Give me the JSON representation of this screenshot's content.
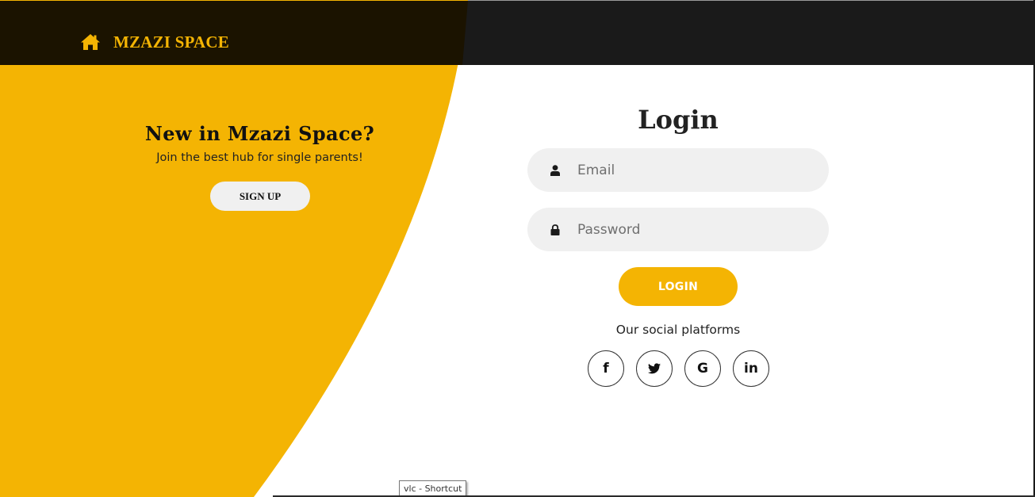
{
  "brand": {
    "name": "MZAZI SPACE",
    "icon": "home-icon"
  },
  "promo": {
    "title": "New in Mzazi Space?",
    "subtitle": "Join the best hub for single parents!",
    "signup_label": "SIGN UP"
  },
  "login": {
    "title": "Login",
    "email": {
      "placeholder": "Email",
      "value": "",
      "icon": "user-icon"
    },
    "password": {
      "placeholder": "Password",
      "value": "",
      "icon": "lock-icon"
    },
    "button_label": "LOGIN"
  },
  "social": {
    "heading": "Our social platforms",
    "platforms": [
      {
        "name": "facebook",
        "glyph": "f"
      },
      {
        "name": "twitter",
        "glyph": ""
      },
      {
        "name": "google",
        "glyph": "G"
      },
      {
        "name": "linkedin",
        "glyph": "in"
      }
    ]
  },
  "tooltip": {
    "text": "vlc - Shortcut"
  },
  "colors": {
    "accent": "#f4b403",
    "navbar": "#1a1a1a",
    "field_bg": "#f0f0f0"
  }
}
